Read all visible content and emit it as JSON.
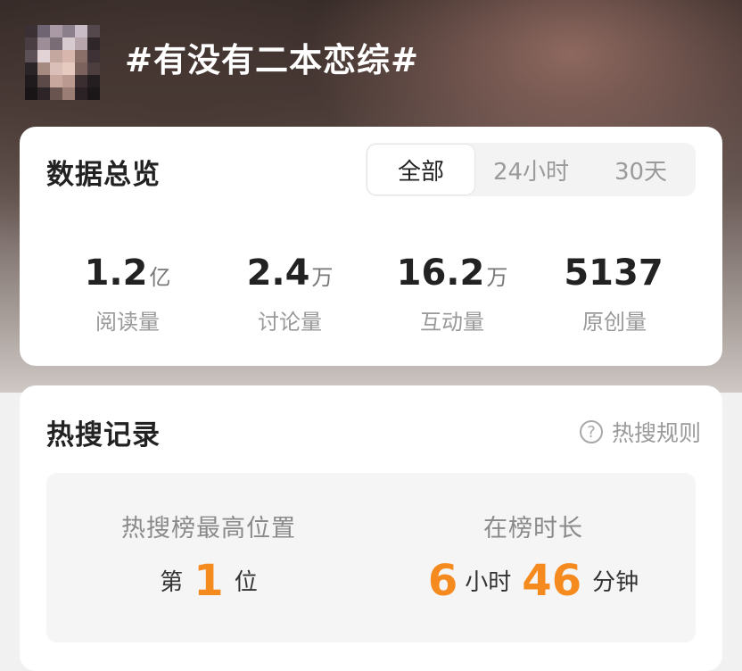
{
  "topic": {
    "title": "#有没有二本恋综#"
  },
  "overview": {
    "title": "数据总览",
    "tabs": [
      {
        "label": "全部",
        "active": true
      },
      {
        "label": "24小时",
        "active": false
      },
      {
        "label": "30天",
        "active": false
      }
    ],
    "stats": [
      {
        "value": "1.2",
        "unit": "亿",
        "label": "阅读量"
      },
      {
        "value": "2.4",
        "unit": "万",
        "label": "讨论量"
      },
      {
        "value": "16.2",
        "unit": "万",
        "label": "互动量"
      },
      {
        "value": "5137",
        "unit": "",
        "label": "原创量"
      }
    ]
  },
  "hot_search": {
    "title": "热搜记录",
    "rules_label": "热搜规则",
    "rules_icon": "help-circle-icon",
    "highest_position": {
      "label": "热搜榜最高位置",
      "prefix": "第",
      "value": "1",
      "suffix": "位"
    },
    "duration": {
      "label": "在榜时长",
      "hours": "6",
      "hours_unit": "小时",
      "minutes": "46",
      "minutes_unit": "分钟"
    }
  },
  "colors": {
    "accent": "#f58a1f",
    "card_bg": "#ffffff",
    "page_bg": "#f1f1f1"
  }
}
